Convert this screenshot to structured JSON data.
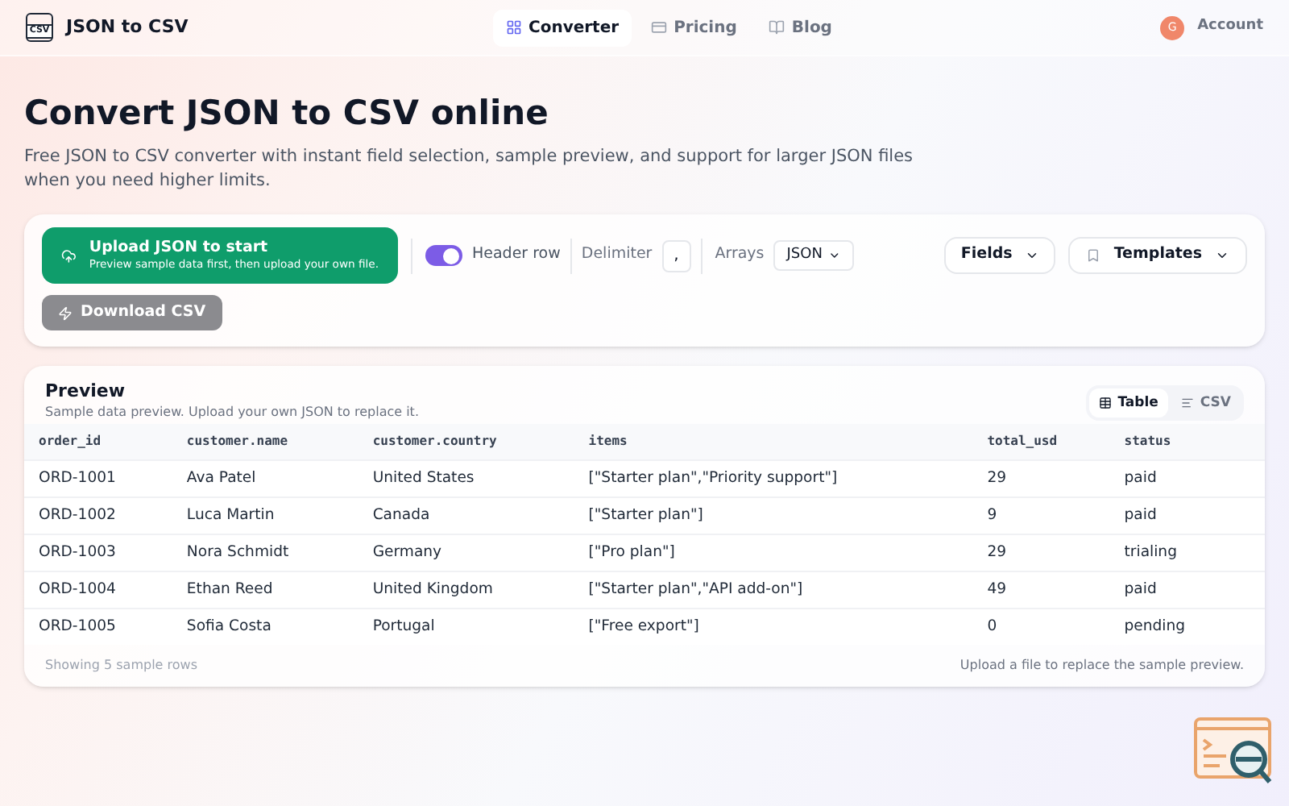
{
  "brand": {
    "name": "JSON to CSV",
    "logo_text": "CSV"
  },
  "nav": [
    {
      "label": "Converter",
      "selected": true
    },
    {
      "label": "Pricing",
      "selected": false
    },
    {
      "label": "Blog",
      "selected": false
    }
  ],
  "account": {
    "initial": "G",
    "label": "Account"
  },
  "hero": {
    "title": "Convert JSON to CSV online",
    "subtitle": "Free JSON to CSV converter with instant field selection, sample preview, and support for larger JSON files when you need higher limits."
  },
  "toolbar": {
    "upload": {
      "title": "Upload JSON to start",
      "subtitle": "Preview sample data first, then upload your own file."
    },
    "header_row": {
      "label": "Header row",
      "on": true
    },
    "delimiter": {
      "label": "Delimiter",
      "value": ","
    },
    "arrays": {
      "label": "Arrays",
      "value": "JSON"
    },
    "fields": "Fields",
    "templates": "Templates",
    "download": {
      "label": "Download CSV",
      "disabled": true
    }
  },
  "preview": {
    "title": "Preview",
    "subtitle": "Sample data preview. Upload your own JSON to replace it.",
    "views": [
      {
        "label": "Table",
        "selected": true
      },
      {
        "label": "CSV",
        "selected": false
      }
    ],
    "columns": [
      "order_id",
      "customer.name",
      "customer.country",
      "items",
      "total_usd",
      "status"
    ],
    "rows": [
      [
        "ORD-1001",
        "Ava Patel",
        "United States",
        "[\"Starter plan\",\"Priority support\"]",
        "29",
        "paid"
      ],
      [
        "ORD-1002",
        "Luca Martin",
        "Canada",
        "[\"Starter plan\"]",
        "9",
        "paid"
      ],
      [
        "ORD-1003",
        "Nora Schmidt",
        "Germany",
        "[\"Pro plan\"]",
        "29",
        "trialing"
      ],
      [
        "ORD-1004",
        "Ethan Reed",
        "United Kingdom",
        "[\"Starter plan\",\"API add-on\"]",
        "49",
        "paid"
      ],
      [
        "ORD-1005",
        "Sofia Costa",
        "Portugal",
        "[\"Free export\"]",
        "0",
        "pending"
      ]
    ],
    "footer_left": "Showing 5 sample rows",
    "footer_right": "Upload a file to replace the sample preview."
  }
}
